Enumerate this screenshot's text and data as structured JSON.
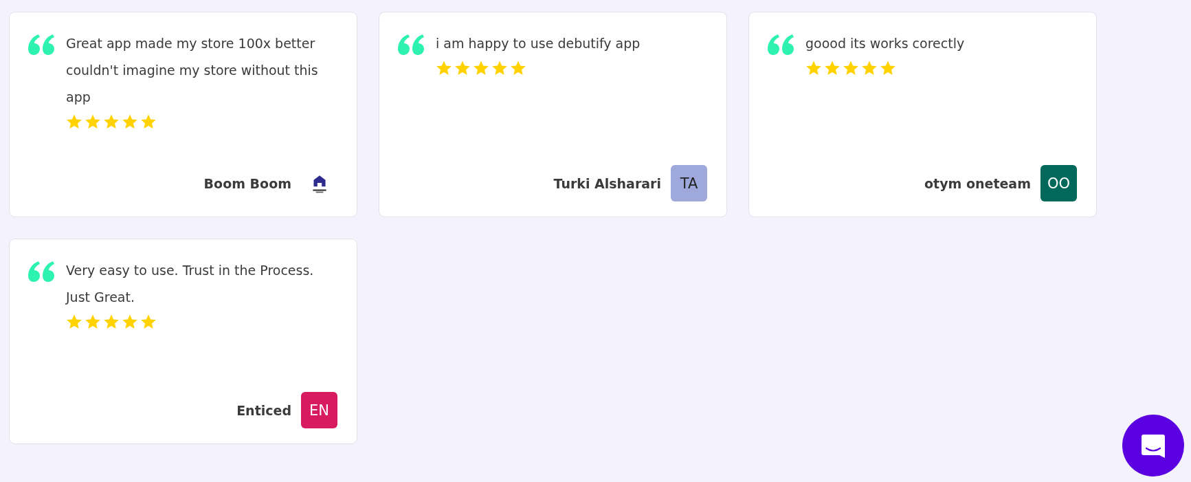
{
  "reviews": [
    {
      "text": "Great app made my store 100x better couldn't imagine my store without this app",
      "stars": 5,
      "author": "Boom Boom",
      "avatar": {
        "kind": "logo"
      }
    },
    {
      "text": "i am happy to use debutify app",
      "stars": 5,
      "author": "Turki Alsharari",
      "avatar": {
        "kind": "initials",
        "initials": "TA",
        "color": "#9fa8da"
      }
    },
    {
      "text": "goood its works corectly",
      "stars": 5,
      "author": "otym oneteam",
      "avatar": {
        "kind": "initials",
        "initials": "OO",
        "color": "#00695c"
      }
    },
    {
      "text": "Very easy to use. Trust in the Process. Just Great.",
      "stars": 5,
      "author": "Enticed",
      "avatar": {
        "kind": "initials",
        "initials": "EN",
        "color": "#d81b60"
      }
    }
  ]
}
